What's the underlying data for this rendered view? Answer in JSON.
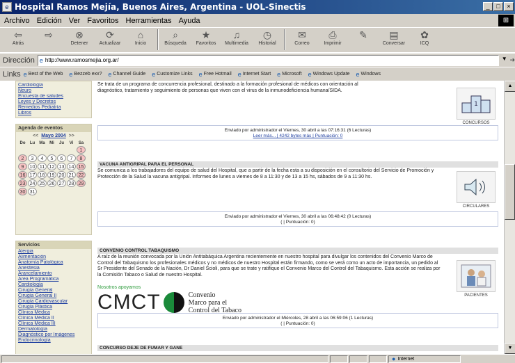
{
  "window": {
    "title": "Hospital Ramos Mejía, Buenos Aires, Argentina - UOL-Sinectis"
  },
  "menu": [
    "Archivo",
    "Edición",
    "Ver",
    "Favoritos",
    "Herramientas",
    "Ayuda"
  ],
  "toolbar": [
    {
      "label": "Atrás",
      "icon": "back-arrow-icon"
    },
    {
      "label": "",
      "icon": "forward-arrow-icon"
    },
    {
      "label": "Detener",
      "icon": "stop-icon"
    },
    {
      "label": "Actualizar",
      "icon": "refresh-icon"
    },
    {
      "label": "Inicio",
      "icon": "home-icon"
    },
    {
      "label": "Búsqueda",
      "icon": "search-icon"
    },
    {
      "label": "Favoritos",
      "icon": "favorites-icon"
    },
    {
      "label": "Multimedia",
      "icon": "media-icon"
    },
    {
      "label": "Historial",
      "icon": "history-icon"
    },
    {
      "label": "Correo",
      "icon": "mail-icon"
    },
    {
      "label": "Imprimir",
      "icon": "print-icon"
    },
    {
      "label": "",
      "icon": "edit-icon"
    },
    {
      "label": "Conversar",
      "icon": "discuss-icon"
    },
    {
      "label": "ICQ",
      "icon": "icq-icon"
    }
  ],
  "address": {
    "label": "Dirección",
    "url": "http://www.ramosmejia.org.ar/"
  },
  "links": {
    "label": "Links",
    "items": [
      "Best of the Web",
      "Bezzeb exx?",
      "Channel Guide",
      "Customize Links",
      "Free Hotmail",
      "Internet Start",
      "Microsoft",
      "Windows Update",
      "Windows"
    ]
  },
  "left": {
    "top_links": [
      "Cardiología",
      "Neuro",
      "Encuesta de saludes",
      "Leyes y Decretos",
      "Remedios Pediatría",
      "Libros"
    ],
    "agenda": {
      "title": "Agenda de eventos",
      "prev": "<<",
      "month": "Mayo 2004",
      "next": ">>",
      "dow": [
        "Do",
        "Lu",
        "Ma",
        "Mi",
        "Ju",
        "Vi",
        "Sa"
      ],
      "weeks": [
        [
          "",
          "",
          "",
          "",
          "",
          "",
          "1"
        ],
        [
          "2",
          "3",
          "4",
          "5",
          "6",
          "7",
          "8"
        ],
        [
          "9",
          "10",
          "11",
          "12",
          "13",
          "14",
          "15"
        ],
        [
          "16",
          "17",
          "18",
          "19",
          "20",
          "21",
          "22"
        ],
        [
          "23",
          "24",
          "25",
          "26",
          "27",
          "28",
          "29"
        ],
        [
          "30",
          "31",
          "",
          "",
          "",
          "",
          ""
        ]
      ]
    },
    "servicios": {
      "title": "Servicios",
      "items": [
        "Alergia",
        "Alimentación",
        "Anatomía Patológica",
        "Anestesia",
        "Arancelamiento",
        "Área Programática",
        "Cardiología",
        "Cirugía General",
        "Cirugía General II",
        "Cirugía Cardiovascular",
        "Cirugía Plástica",
        "Clínica Médica",
        "Clínica Médica II",
        "Clínica Médica III",
        "Dermatología",
        "Diagnóstico por Imágenes",
        "Endocrinología"
      ]
    }
  },
  "main": {
    "s1": {
      "text_line1": "Se trata de un programa de concurrencia profesional, destinado a la formación profesional de médicos con orientación al",
      "text_line2": "diagnóstico, tratamiento y seguimiento de personas que viven con el virus de la inmunodeficiencia humana/SIDA.",
      "meta1": "Enviado por administrador el Viernes, 30 abril a las 07:16:31 (6 Lecturas)",
      "meta2": "Leer más... | 4242 bytes más | Puntuación: 0",
      "thumb_caption": "CONCURSOS"
    },
    "s2": {
      "title": "VACUNA ANTIGRIPAL PARA EL PERSONAL",
      "text": "Se comunica a los trabajadores del equipo de salud del Hospital, que a partir de la fecha esta a su disposición en el consultorio del Servicio de Promoción y Protección de la Salud la vacuna antigripal. Informes de lunes a viernes de 8 a 11:30 y de 13 a 15 hs, sábados de 9 a 11:30 hs.",
      "meta1": "Enviado por administrador el Viernes, 30 abril a las 06:48:42 (0 Lecturas)",
      "meta2": "( | Puntuación: 0)",
      "thumb_caption": "CIRCULARES"
    },
    "s3": {
      "title": "CONVENIO CONTROL TABAQUISMO",
      "text": "A raíz de la reunión convocada por la Unión Antitabáquica Argentina recientemente en nuestro hospital para divulgar los contenidos del Convenio Marco de Control del Tabaquismo los profesionales médicos y no médicos de nuestro Hospital están firmando, como se verá como un acto de importancia, un pedido al Sr Presidente del Senado de la Nación, Dr Daniel Scioli, para que se trate y ratifique el Convenio Marco del Control del Tabaquismo. Esta acción se realiza por la Comisión Tabaco o Salud de nuestro Hospital.",
      "green_label": "Nosotros apoyamos",
      "cmct": "CMCT",
      "cmct_text": [
        "Convenio",
        "Marco para el",
        "Control del Tabaco"
      ],
      "meta1": "Enviado por administrador el Miércoles, 28 abril a las 06:59:06 (1 Lecturas)",
      "meta2": "( | Puntuación: 0)",
      "thumb_caption": "PACIENTES"
    },
    "s4": {
      "title": "CONCURSO DEJE DE FUMAR Y GANE"
    }
  },
  "status": {
    "zone": "Internet"
  },
  "colors": {
    "titlebar_start": "#0a246a",
    "titlebar_end": "#3a6ea5",
    "chrome": "#d4d0c8",
    "panel_bg": "#f0eedd",
    "weekend": "#f7c3c3",
    "link": "#1f3fa0"
  }
}
